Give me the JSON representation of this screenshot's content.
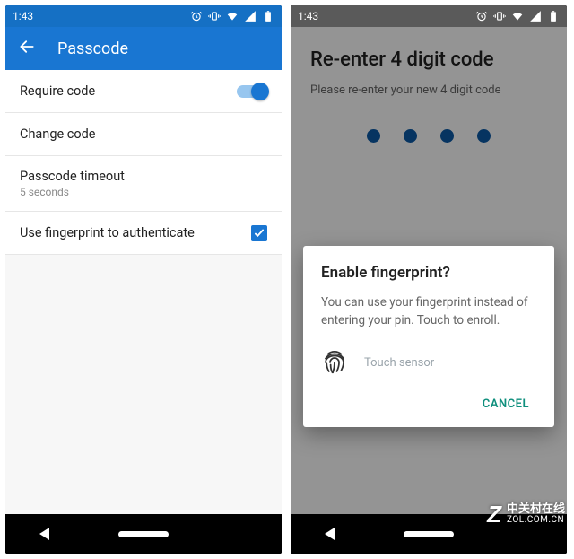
{
  "status": {
    "time": "1:43",
    "icons": [
      "alarm-icon",
      "vibrate-icon",
      "wifi-icon",
      "signal-icon",
      "battery-icon"
    ]
  },
  "left": {
    "title": "Passcode",
    "rows": {
      "require": {
        "label": "Require code",
        "value": true
      },
      "change": {
        "label": "Change code"
      },
      "timeout": {
        "label": "Passcode timeout",
        "sub": "5 seconds"
      },
      "fingerprint": {
        "label": "Use fingerprint to authenticate",
        "value": true
      }
    }
  },
  "right": {
    "title": "Re-enter 4 digit code",
    "sub": "Please re-enter your new 4 digit code",
    "entered_digits": 4,
    "dialog": {
      "title": "Enable fingerprint?",
      "body": "You can use your fingerprint instead of entering your pin. Touch to enroll.",
      "sensor_label": "Touch sensor",
      "cancel": "CANCEL"
    }
  },
  "watermark": {
    "cn": "中关村在线",
    "url": "ZOL.COM.CN"
  }
}
